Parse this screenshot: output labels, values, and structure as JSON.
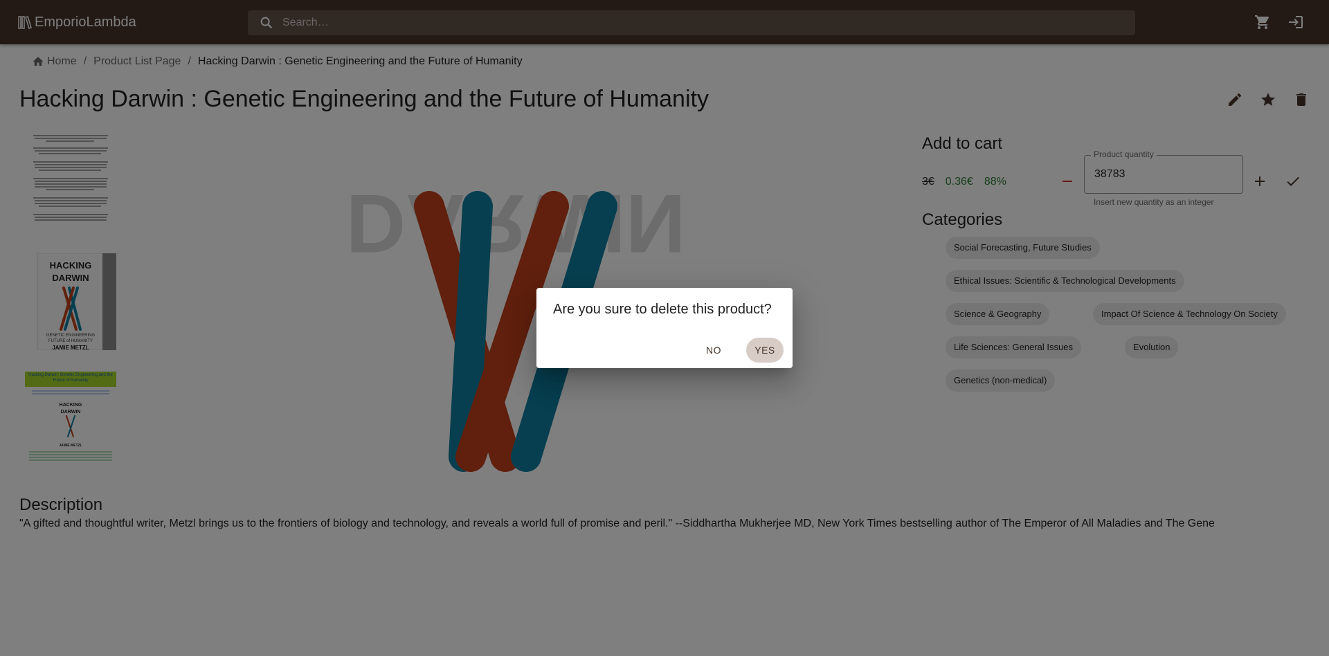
{
  "app": {
    "title": "EmporioLambda"
  },
  "search": {
    "placeholder": "Search…"
  },
  "header_icons": [
    "cart-icon",
    "login-icon"
  ],
  "breadcrumb": {
    "home": "Home",
    "list": "Product List Page",
    "current": "Hacking Darwin : Genetic Engineering and the Future of Humanity"
  },
  "product": {
    "title": "Hacking Darwin : Genetic Engineering and the Future of Humanity",
    "actions": [
      "edit-icon",
      "star-icon",
      "delete-icon"
    ]
  },
  "cart": {
    "title": "Add to cart",
    "old_price": "3€",
    "new_price": "0.36€",
    "discount": "88%",
    "quantity_label": "Product quantity",
    "quantity_value": "38783",
    "quantity_helper": "Insert new quantity as an integer"
  },
  "categories": {
    "title": "Categories",
    "items": [
      "Social Forecasting, Future Studies",
      "Ethical Issues: Scientific & Technological Developments",
      "Science & Geography",
      "Impact Of Science & Technology On Society",
      "Life Sciences: General Issues",
      "Evolution",
      "Genetics (non-medical)"
    ]
  },
  "description": {
    "title": "Description",
    "text": "\"A gifted and thoughtful writer, Metzl brings us to the frontiers of biology and technology, and reveals a world full of promise and peril.\" --Siddhartha Mukherjee MD, New York Times bestselling author of The Emperor of All Maladies and The Gene"
  },
  "cover": {
    "spine_title_1": "HACKING",
    "spine_title_2": "DARWIN",
    "subtitle_1": "GENETIC ENGINEERING",
    "subtitle_2": "FUTURE of HUMANITY",
    "author": "JAMIE METZL",
    "banner": "Hacking Darwin: Genetic Engineering and the Future of Humanity",
    "big_word": "DARWIN"
  },
  "dialog": {
    "title": "Are you sure to delete this product?",
    "no": "NO",
    "yes": "YES"
  },
  "colors": {
    "appbar": "#48352a",
    "accent_green": "#2e7d32",
    "chromosome_orange": "#c0401a",
    "chromosome_blue": "#0f7ea0"
  }
}
